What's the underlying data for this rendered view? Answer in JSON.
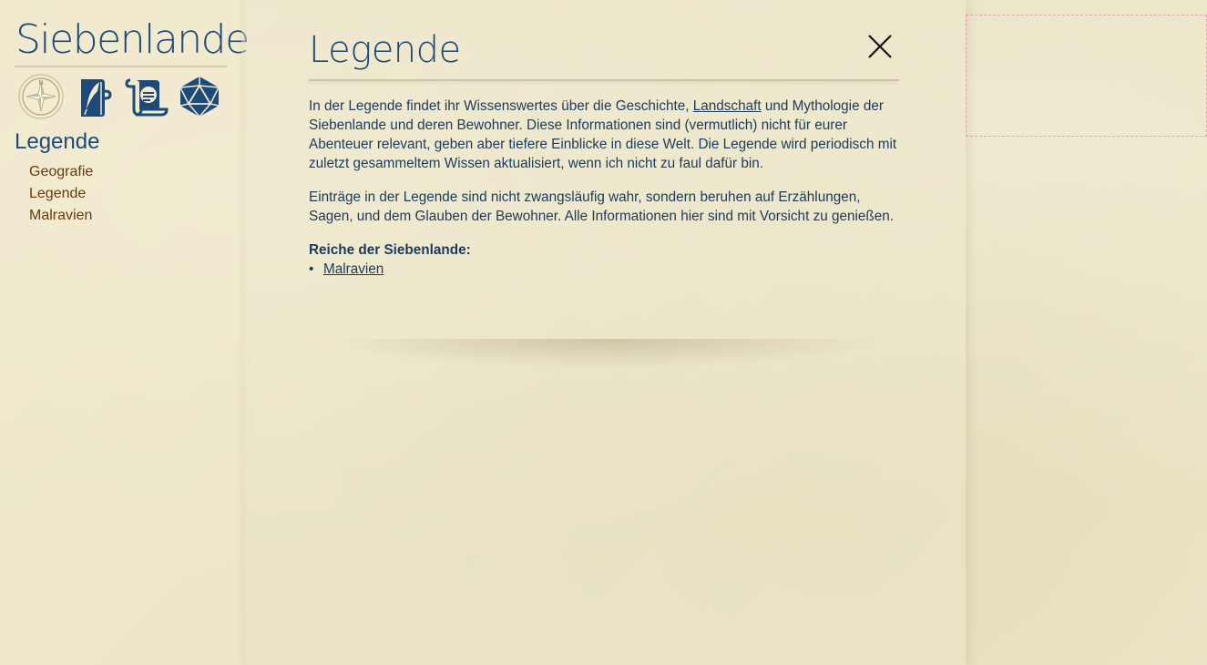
{
  "site": {
    "title": "Siebenlande"
  },
  "nav_icons": [
    {
      "name": "compass-icon",
      "active": true
    },
    {
      "name": "quill-book-icon",
      "active": false
    },
    {
      "name": "scroll-icon",
      "active": false
    },
    {
      "name": "d20-icon",
      "active": false
    }
  ],
  "sidebar": {
    "heading": "Legende",
    "items": [
      {
        "label": "Geografie"
      },
      {
        "label": "Legende"
      },
      {
        "label": "Malravien"
      }
    ]
  },
  "page": {
    "title": "Legende",
    "para1_before": "In der Legende findet ihr Wissenswertes über die Geschichte, ",
    "para1_link": "Landschaft",
    "para1_after": " und Mythologie der Siebenlande und deren Bewohner. Diese Informationen sind (vermutlich) nicht für eurer Abenteuer relevant, geben aber tiefere Einblicke in diese Welt. Die Legende wird periodisch mit zuletzt gesammeltem Wissen aktualisiert, wenn ich nicht zu faul dafür bin.",
    "para2": "Einträge in der Legende sind nicht zwangsläufig wahr, sondern beruhen auf Erzählungen, Sagen, und dem Glauben der Bewohner. Alle Informationen hier sind mit Vorsicht zu genießen.",
    "kingdoms_heading": "Reiche der Siebenlande:",
    "kingdoms": [
      {
        "label": "Malravien"
      }
    ],
    "bullet": "•"
  },
  "colors": {
    "accent": "#1d4a78",
    "text": "#1d3a5c",
    "nav_link": "#6b3a10",
    "paper": "#ece5c6"
  }
}
